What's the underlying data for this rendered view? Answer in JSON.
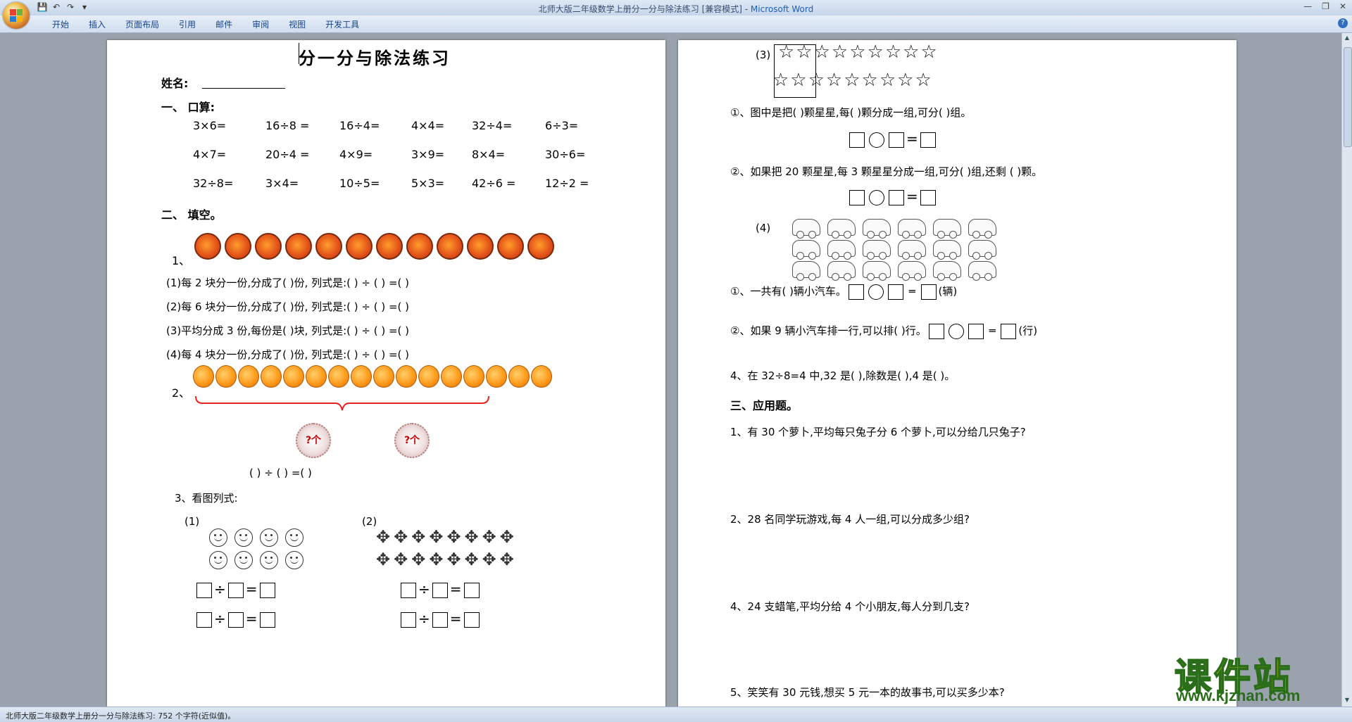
{
  "window": {
    "title": "北师大版二年级数学上册分一分与除法练习 [兼容模式] - ",
    "app": "Microsoft Word"
  },
  "ribbon": {
    "tabs": [
      "开始",
      "插入",
      "页面布局",
      "引用",
      "邮件",
      "审阅",
      "视图",
      "开发工具"
    ]
  },
  "status": {
    "text": "北师大版二年级数学上册分一分与除法练习: 752 个字符(近似值)。"
  },
  "page1": {
    "title": "分一分与除法练习",
    "name_label": "姓名:",
    "sec1": "一、    口算:",
    "oral": [
      [
        "3×6=",
        "16÷8 =",
        "16÷4=",
        "4×4=",
        "32÷4=",
        "6÷3="
      ],
      [
        "4×7=",
        "20÷4 =",
        "4×9=",
        "3×9=",
        "8×4=",
        "30÷6="
      ],
      [
        "32÷8=",
        "3×4=",
        "10÷5=",
        "5×3=",
        "42÷6 =",
        "12÷2 ="
      ]
    ],
    "sec2": "二、   填空。",
    "q1_num": "1、",
    "fill_lines": [
      "(1)每 2 块分一份,分成了(    )份,  列式是:(     )  ÷  (     ) =(     )",
      "(2)每 6 块分一份,分成了(    )份,   列式是:(     )  ÷  (     ) =(     )",
      "(3)平均分成 3 份,每份是(    )块,   列式是:(     )  ÷  (     ) =(     )",
      "(4)每 4 块分一份,分成了(    )份,   列式是:(     )  ÷  (     ) =(     )"
    ],
    "q2_num": "2、",
    "question_badge": "?个",
    "division_line": "(       )  ÷  (        ) =(        )",
    "q3": "3、看图列式:",
    "sub1": "(1)",
    "sub2": "(2)",
    "div_sign": "÷",
    "eq_sign": "="
  },
  "page2": {
    "q3_label": "(3)",
    "stars_row1": "☆☆☆☆☆☆☆☆☆",
    "stars_row2": "☆☆☆☆☆☆☆☆☆",
    "line1": "①、图中是把(   )颗星星,每(   )颗分成一组,可分(   )组。",
    "line2": "②、如果把 20 颗星星,每 3 颗星星分成一组,可分(   )组,还剩 (   )颗。",
    "q4_label": "(4)",
    "line3": "①、一共有(    )辆小汽车。",
    "unit_car": "(辆)",
    "line4": "②、如果 9 辆小汽车排一行,可以排(    )行。",
    "unit_row": "(行)",
    "line5": "4、在 32÷8=4 中,32 是(        ),除数是(       ),4 是(       )。",
    "sec3": "三、应用题。",
    "app1": "1、有 30 个萝卜,平均每只兔子分 6 个萝卜,可以分给几只兔子?",
    "app2": "2、28 名同学玩游戏,每 4 人一组,可以分成多少组?",
    "app4": "4、24 支蜡笔,平均分给 4 个小朋友,每人分到几支?",
    "app5": "5、笑笑有 30 元钱,想买 5 元一本的故事书,可以买多少本?",
    "eq": "=",
    "dash_eq": "═"
  },
  "watermark": {
    "cn": "课件站",
    "url": "www.kjzhan.com"
  },
  "colors": {
    "bracket": "#e8231f",
    "ribbon_text": "#15428b"
  }
}
